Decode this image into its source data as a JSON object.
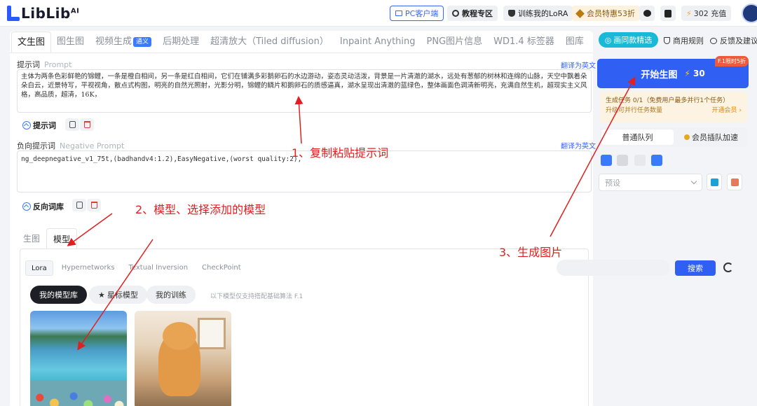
{
  "header": {
    "logo": "LibLib",
    "logo_sup": "AI",
    "pc_client": "PC客户端",
    "tutorials": "教程专区",
    "train_lora": "训练我的LoRA",
    "vip_offer": "会员特惠53折",
    "credits": "302 充值"
  },
  "tabs": [
    {
      "label": "文生图"
    },
    {
      "label": "图生图"
    },
    {
      "label": "视频生成",
      "badge": "通义"
    },
    {
      "label": "后期处理"
    },
    {
      "label": "超清放大（Tiled diffusion）"
    },
    {
      "label": "Inpaint Anything"
    },
    {
      "label": "PNG图片信息"
    },
    {
      "label": "WD1.4 标签器"
    },
    {
      "label": "图库"
    }
  ],
  "prompt": {
    "label": "提示词",
    "label_sub": "Prompt",
    "translate": "翻译为英文",
    "value": "主体为两条色彩鲜艳的锦鲤，一条是橙白相间，另一条是红白相间，它们在铺满多彩鹅卵石的水边游动，姿态灵动活泼，背景是一片清澈的湖水，远处有葱郁的树林和连绵的山脉，天空中飘着朵朵白云，近景特写，平视视角，散点式构图，明亮的自然光照射，光影分明，锦鲤的鳞片和鹅卵石的质感逼真，湖水呈现出清澈的蓝绿色，整体画面色调清新明亮，充满自然生机，超现实主义风格，高品质，超清，16K，",
    "words_btn": "提示词"
  },
  "negative": {
    "label": "负向提示词",
    "label_sub": "Negative Prompt",
    "translate": "翻译为英文",
    "value": "ng_deepnegative_v1_75t,(badhandv4:1.2),EasyNegative,(worst quality:2),",
    "words_btn": "反向词库"
  },
  "subtabs": [
    "生图",
    "模型"
  ],
  "model_tabs": [
    "Lora",
    "Hypernetworks",
    "Textual Inversion",
    "CheckPoint"
  ],
  "search": {
    "placeholder": "",
    "button": "搜索"
  },
  "filters": [
    "我的模型库",
    "星标模型",
    "我的训练"
  ],
  "filter_note": "以下模型仅支持搭配基础算法 F.1",
  "annotations": {
    "a1": "1、复制粘贴提示词",
    "a2": "2、模型、选择添加的模型",
    "a3": "3、生成图片"
  },
  "right": {
    "picks": "画同款精选",
    "rules": "商用规则",
    "feedback": "反馈及建议",
    "generate": "开始生图",
    "cost": "30",
    "promo": "F.1限时5折",
    "task_line1": "生成任务 0/1（免费用户最多并行1个任务）",
    "task_line2": "升级可并行任务数量",
    "task_vip": "开通会员 ›",
    "queue_normal": "普通队列",
    "queue_vip": "会员插队加速",
    "preset": "预设"
  },
  "colors": {
    "primary": "#2f5ff3",
    "annotation": "#e02020",
    "teal": "#18b9d6"
  }
}
